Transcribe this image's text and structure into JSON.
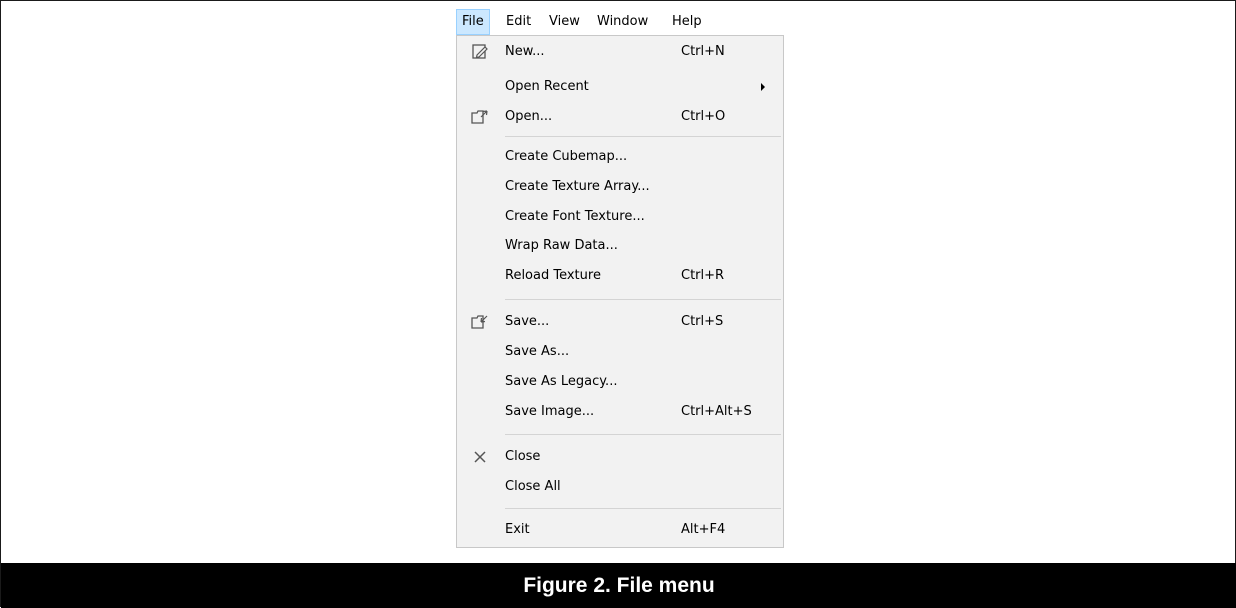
{
  "menubar": {
    "items": [
      {
        "label": "File",
        "active": true
      },
      {
        "label": "Edit"
      },
      {
        "label": "View"
      },
      {
        "label": "Window"
      },
      {
        "label": "Help"
      }
    ]
  },
  "file_menu": {
    "items": [
      {
        "label": "New...",
        "shortcut": "Ctrl+N",
        "icon": "new-document-icon"
      },
      {
        "label": "Open Recent",
        "submenu": true
      },
      {
        "label": "Open...",
        "shortcut": "Ctrl+O",
        "icon": "open-folder-icon"
      },
      {
        "label": "Create Cubemap..."
      },
      {
        "label": "Create Texture Array..."
      },
      {
        "label": "Create Font Texture..."
      },
      {
        "label": "Wrap Raw Data..."
      },
      {
        "label": "Reload Texture",
        "shortcut": "Ctrl+R"
      },
      {
        "label": "Save...",
        "shortcut": "Ctrl+S",
        "icon": "save-folder-icon"
      },
      {
        "label": "Save As..."
      },
      {
        "label": "Save As Legacy..."
      },
      {
        "label": "Save Image...",
        "shortcut": "Ctrl+Alt+S"
      },
      {
        "label": "Close",
        "icon": "close-x-icon"
      },
      {
        "label": "Close All"
      },
      {
        "label": "Exit",
        "shortcut": "Alt+F4"
      }
    ]
  },
  "caption": {
    "text": "Figure 2. File menu"
  },
  "colors": {
    "active_menu_bg": "#cce8ff",
    "active_menu_border": "#99d1ff",
    "dropdown_bg": "#f2f2f2",
    "caption_bg": "#000000",
    "caption_text": "#ffffff"
  }
}
